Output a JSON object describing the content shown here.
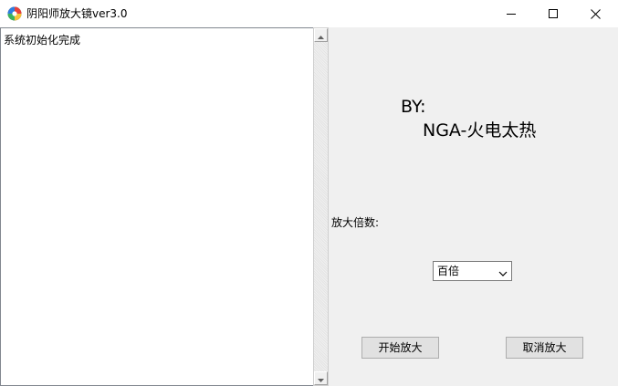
{
  "window": {
    "title": "阴阳师放大镜ver3.0",
    "icon": "app-logo-icon",
    "controls": [
      "minimize-icon",
      "maximize-icon",
      "close-icon"
    ]
  },
  "log": {
    "lines": [
      "系统初始化完成"
    ]
  },
  "credits": {
    "by": "BY:",
    "author": "NGA-火电太热"
  },
  "magnification": {
    "label": "放大倍数:",
    "selected": "百倍"
  },
  "buttons": {
    "start": "开始放大",
    "cancel": "取消放大"
  }
}
